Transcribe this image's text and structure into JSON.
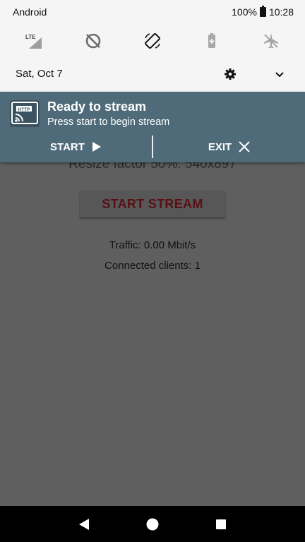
{
  "status_bar": {
    "carrier": "Android",
    "battery": "100%",
    "time": "10:28"
  },
  "quick_settings": {
    "tiles": [
      "lte-signal-icon",
      "data-saver-icon",
      "auto-rotate-icon",
      "battery-saver-icon",
      "airplane-mode-icon"
    ],
    "date": "Sat, Oct 7"
  },
  "notification": {
    "title": "Ready to stream",
    "subtitle": "Press start to begin stream",
    "start_label": "START",
    "exit_label": "EXIT",
    "bg_color": "#4f6b7a"
  },
  "app": {
    "resize_text": "Resize factor 50%: 540x897",
    "start_stream_label": "START STREAM",
    "traffic": "Traffic: 0.00 Mbit/s",
    "clients": "Connected clients: 1"
  },
  "nav": {
    "buttons": [
      "back-icon",
      "home-icon",
      "recents-icon"
    ]
  }
}
